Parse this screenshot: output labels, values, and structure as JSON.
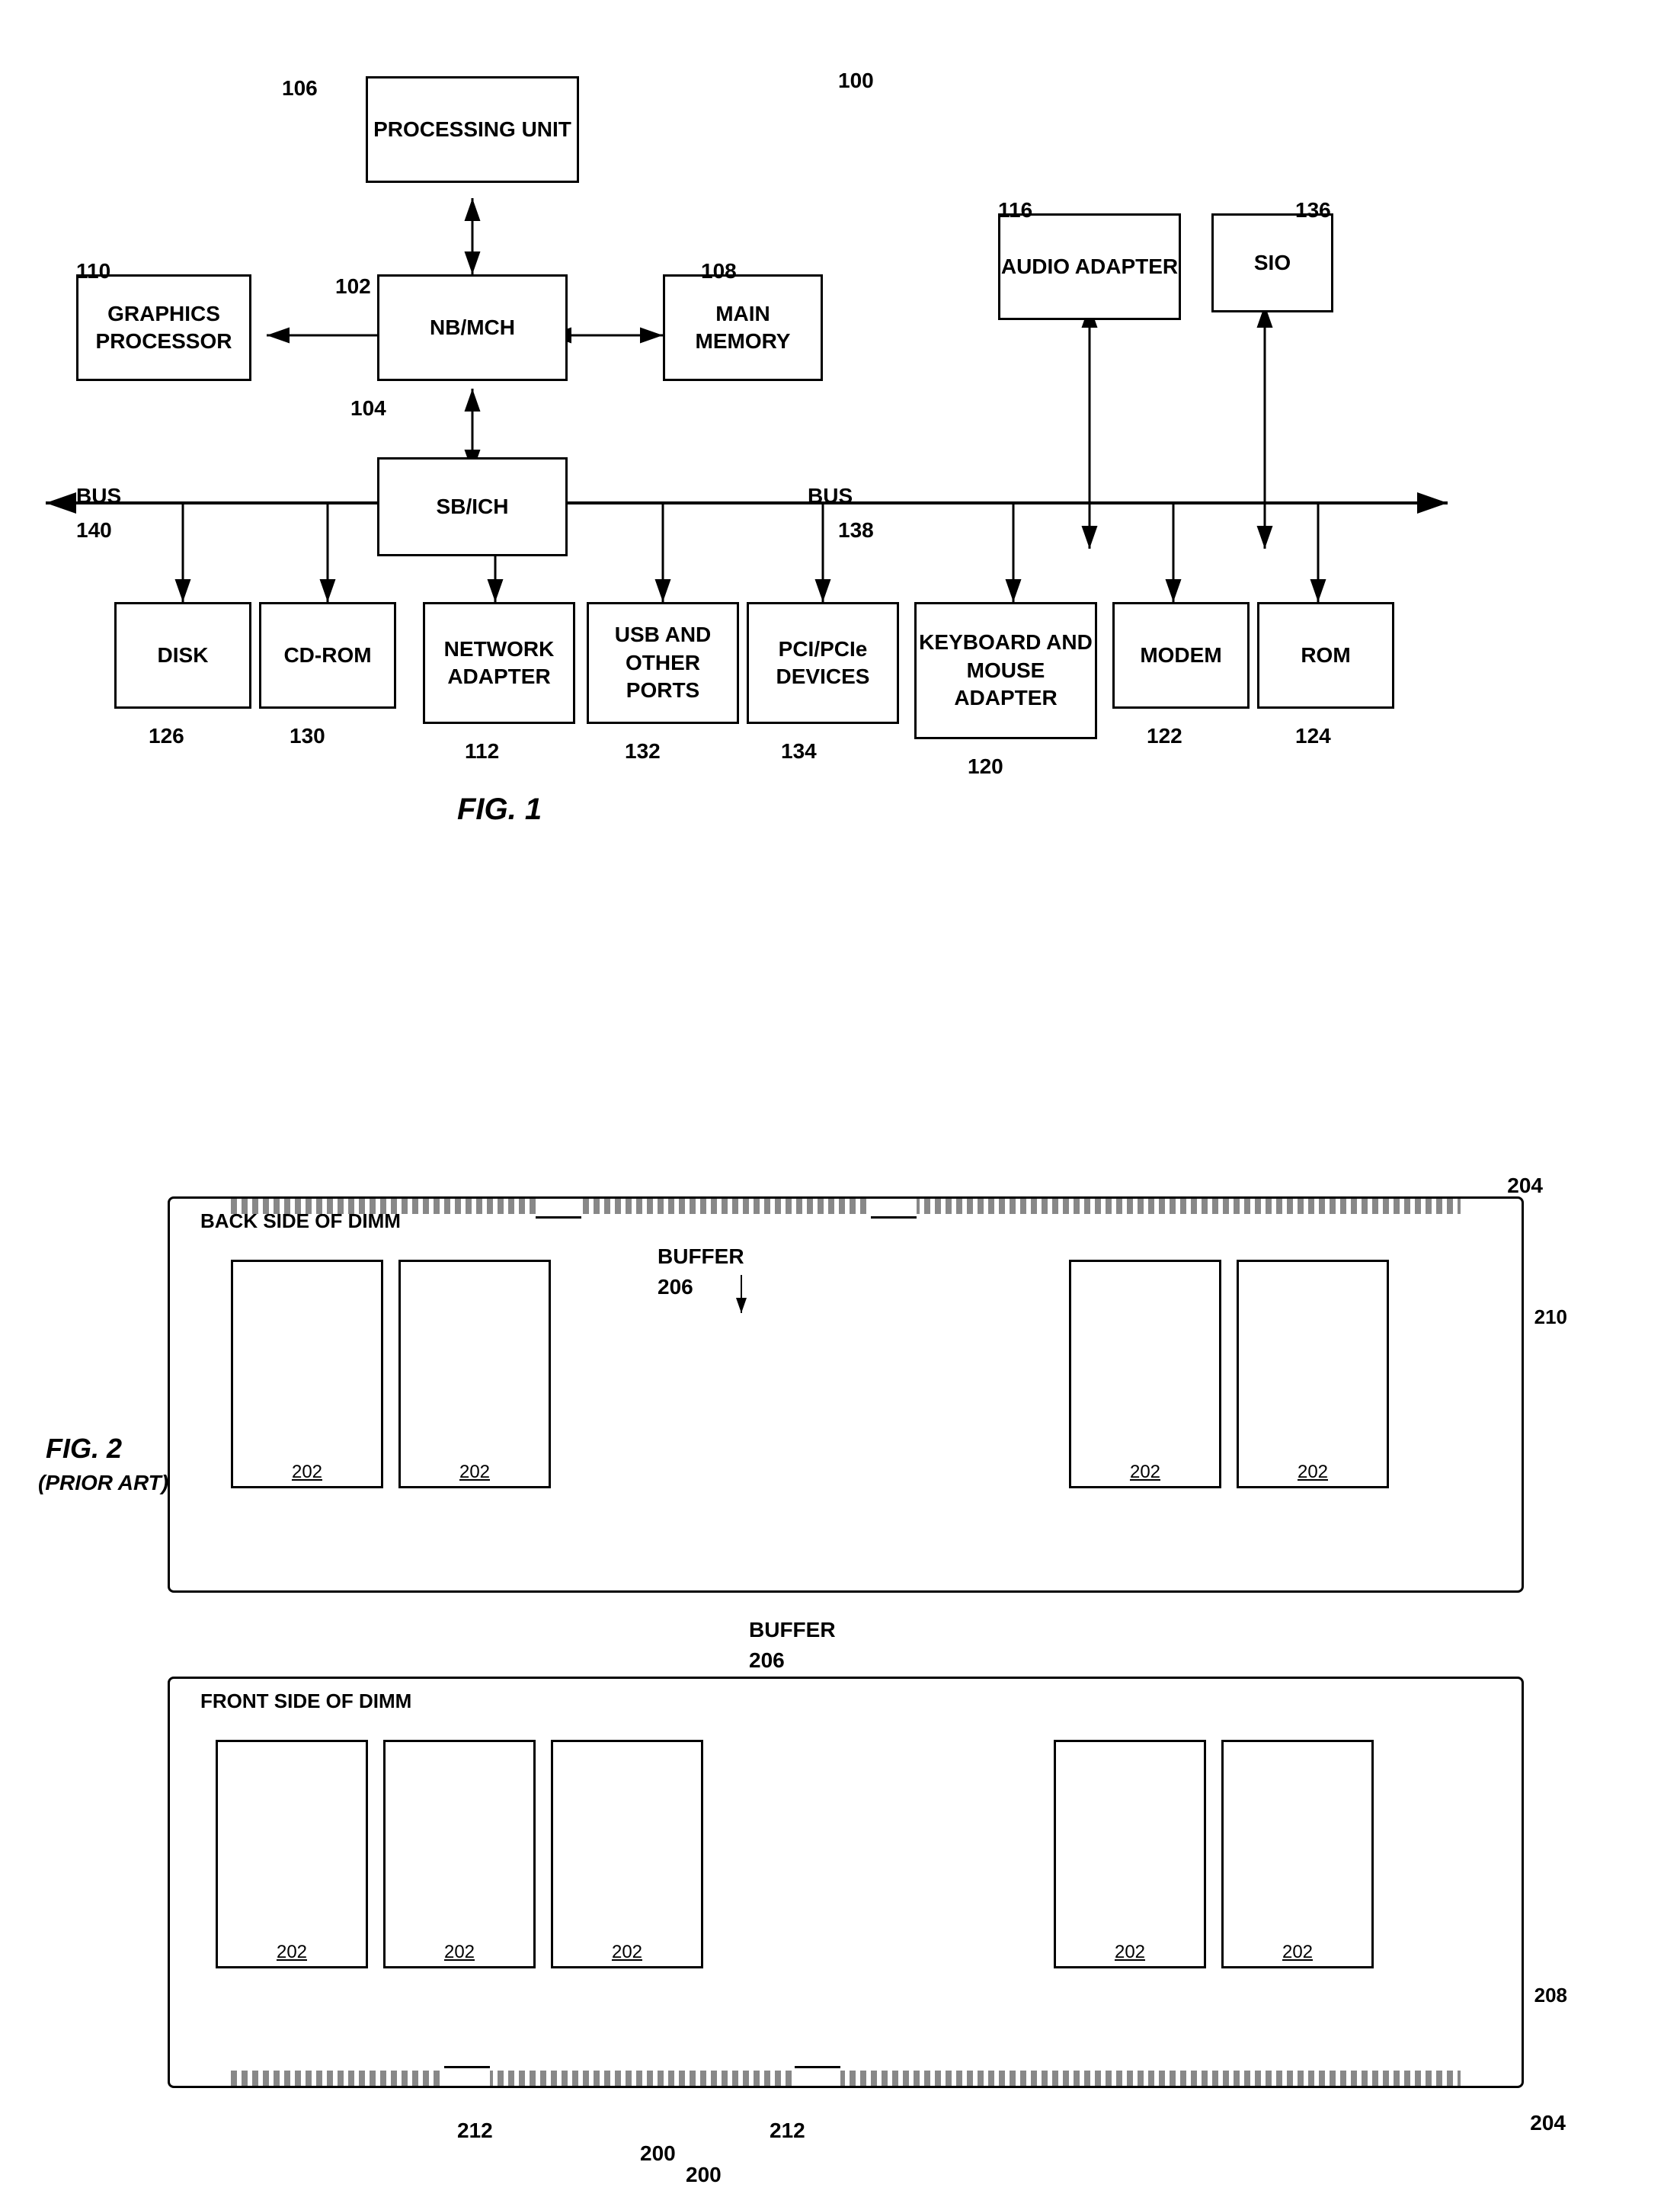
{
  "fig1": {
    "title": "FIG. 1",
    "ref_100": "100",
    "nodes": {
      "processing_unit": {
        "label": "PROCESSING\nUNIT",
        "ref": "106"
      },
      "nb_mch": {
        "label": "NB/MCH",
        "ref": "102"
      },
      "main_memory": {
        "label": "MAIN\nMEMORY",
        "ref": "108"
      },
      "graphics_processor": {
        "label": "GRAPHICS\nPROCESSOR",
        "ref": "110"
      },
      "audio_adapter": {
        "label": "AUDIO\nADAPTER",
        "ref": "116"
      },
      "sio": {
        "label": "SIO",
        "ref": "136"
      },
      "sb_ich": {
        "label": "SB/ICH",
        "ref": "104"
      },
      "bus_label_left": {
        "label": "BUS",
        "ref": "140"
      },
      "bus_label_right": {
        "label": "BUS",
        "ref": "138"
      },
      "disk": {
        "label": "DISK",
        "ref": "126"
      },
      "cd_rom": {
        "label": "CD-ROM",
        "ref": "130"
      },
      "network_adapter": {
        "label": "NETWORK\nADAPTER",
        "ref": "112"
      },
      "usb_ports": {
        "label": "USB AND\nOTHER\nPORTS",
        "ref": "132"
      },
      "pci_devices": {
        "label": "PCI/PCIe\nDEVICES",
        "ref": "134"
      },
      "keyboard_mouse": {
        "label": "KEYBOARD\nAND\nMOUSE\nADAPTER",
        "ref": "120"
      },
      "modem": {
        "label": "MODEM",
        "ref": "122"
      },
      "rom": {
        "label": "ROM",
        "ref": "124"
      }
    }
  },
  "fig2": {
    "title": "FIG. 2",
    "subtitle": "(PRIOR ART)",
    "ref_200": "200",
    "ref_204_top": "204",
    "ref_204_bot": "204",
    "ref_206_back": "BUFFER\n206",
    "ref_206_front": "BUFFER\n206",
    "ref_208": "208",
    "ref_210": "210",
    "ref_212_1": "212",
    "ref_212_2": "212",
    "back_label": "BACK SIDE OF DIMM",
    "front_label": "FRONT SIDE OF DIMM",
    "chip_label": "202",
    "back_chips": [
      "202",
      "202",
      "202",
      "202"
    ],
    "front_chips": [
      "202",
      "202",
      "202",
      "202",
      "202"
    ]
  }
}
